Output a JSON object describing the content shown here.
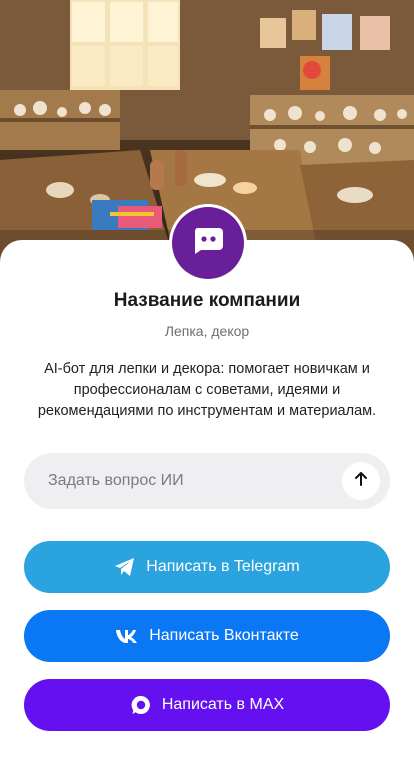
{
  "hero": {
    "image": "pottery-workshop-photo"
  },
  "company": {
    "avatar_icon": "chat-bot-icon",
    "name": "Название компании",
    "category": "Лепка, декор",
    "description": "AI-бот для лепки и декора: помогает новичкам и профессионалам с советами, идеями и рекомендациями по инструментам и материалам."
  },
  "ask": {
    "placeholder": "Задать вопрос ИИ",
    "send_icon": "arrow-up-icon"
  },
  "buttons": {
    "telegram": {
      "label": "Написать в Telegram",
      "icon": "telegram-icon",
      "color": "#2aa3df"
    },
    "vk": {
      "label": "Написать Вконтакте",
      "icon": "vk-icon",
      "color": "#0a77f5"
    },
    "max": {
      "label": "Написать в MAX",
      "icon": "max-icon",
      "color": "#6410f0"
    }
  },
  "colors": {
    "avatar": "#6a1f9a",
    "input_background": "#efeff1"
  }
}
